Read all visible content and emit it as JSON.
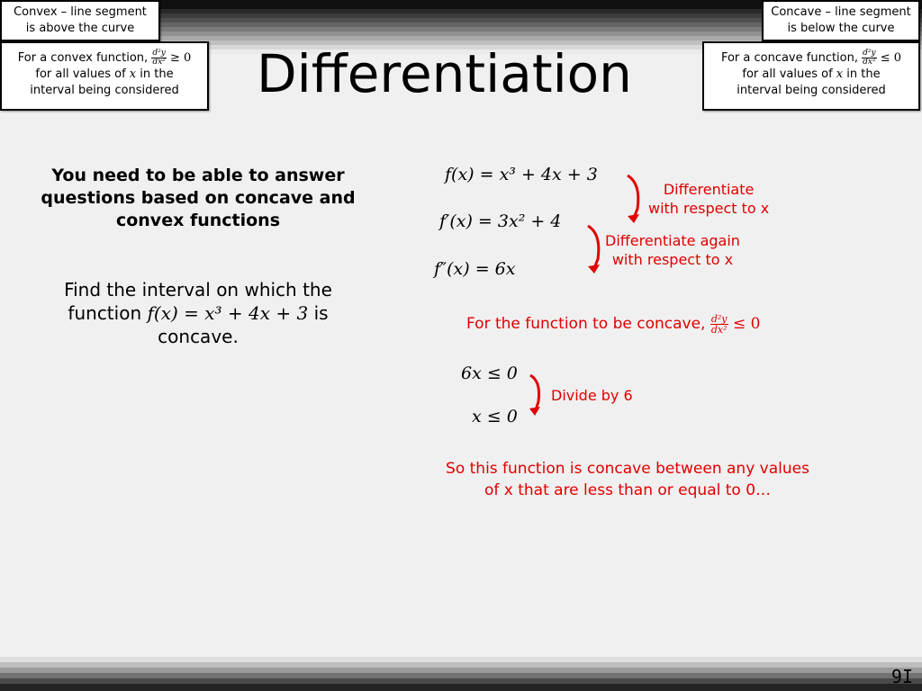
{
  "title": "Differentiation",
  "boxes": {
    "convex_def": "Convex – line segment is above the curve",
    "convex_def_line1": "Convex – line segment",
    "convex_def_line2": "is above the curve",
    "concave_def_line1": "Concave – line segment",
    "concave_def_line2": "is below the curve",
    "convex_rule_prefix": "For a convex function,",
    "convex_rule_op": "≥ 0",
    "concave_rule_prefix": "For a concave function,",
    "concave_rule_op": "≤ 0",
    "rule_line2_a": "for all values of",
    "rule_line2_var": "x",
    "rule_line2_b": "in the",
    "rule_line3": "interval being considered",
    "frac_num": "d²y",
    "frac_den": "dx²"
  },
  "intro": {
    "line1": "You need to be able to answer",
    "line2": "questions based on concave and",
    "line3": "convex functions"
  },
  "question": {
    "line1": "Find the interval on which the",
    "line2_a": "function",
    "line2_fn": "f(x) = x³ + 4x + 3",
    "line2_b": "is",
    "line3": "concave."
  },
  "working": {
    "eq1": "f(x) = x³ + 4x + 3",
    "eq2": "f′(x) = 3x² + 4",
    "eq3": "f″(x) = 6x",
    "note1_line1": "Differentiate",
    "note1_line2": "with respect to x",
    "note2_line1": "Differentiate again",
    "note2_line2": "with respect to x",
    "condition_text": "For the function to be concave,",
    "condition_op": "≤ 0",
    "ineq1": "6x ≤ 0",
    "ineq2": "x ≤ 0",
    "note3": "Divide by 6",
    "conclusion_line1": "So this function is concave between any values",
    "conclusion_line2": "of x that are less than or equal to 0…"
  },
  "slide_number": "9I",
  "colors": {
    "accent_red": "#e00000",
    "background": "#f0f0f0"
  }
}
